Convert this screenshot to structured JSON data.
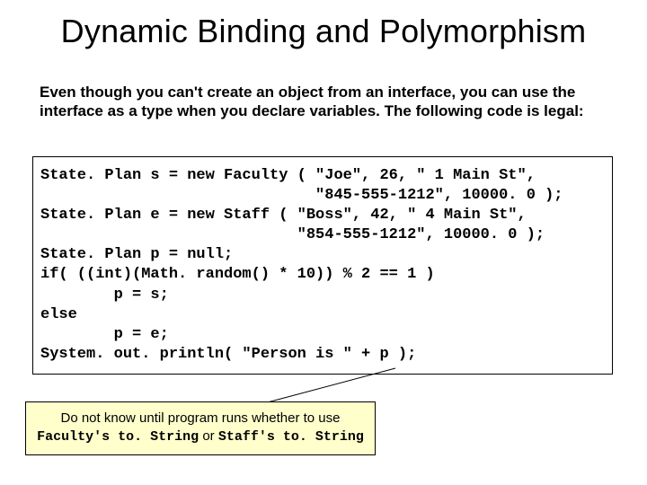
{
  "title": "Dynamic Binding and Polymorphism",
  "intro": "Even though you can't create an object from an interface, you can use the interface as a type when you declare variables.  The following code is legal:",
  "code": "State. Plan s = new Faculty ( \"Joe\", 26, \" 1 Main St\",\n                              \"845-555-1212\", 10000. 0 );\nState. Plan e = new Staff ( \"Boss\", 42, \" 4 Main St\",\n                            \"854-555-1212\", 10000. 0 );\nState. Plan p = null;\nif( ((int)(Math. random() * 10)) % 2 == 1 )\n        p = s;\nelse\n        p = e;\nSystem. out. println( \"Person is \" + p );",
  "callout": {
    "line1": "Do not know until program runs whether to use",
    "mono1": "Faculty's to. String",
    "mid": " or ",
    "mono2": "Staff's to. String"
  }
}
